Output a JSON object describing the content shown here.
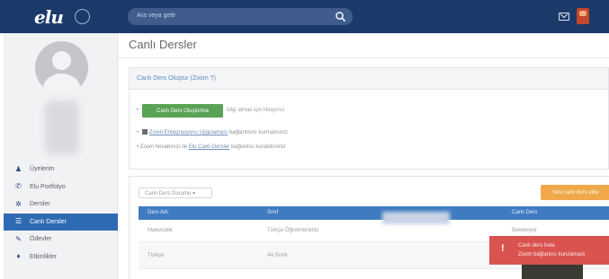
{
  "topbar": {
    "logo": "elu",
    "search_placeholder": "Ara veya getir"
  },
  "sidebar": {
    "items": [
      {
        "icon": "user-icon",
        "glyph": "♟",
        "label": "Üyelerim"
      },
      {
        "icon": "phone-icon",
        "glyph": "✆",
        "label": "Elu Portfolyo"
      },
      {
        "icon": "gear-icon",
        "glyph": "✲",
        "label": "Dersler"
      },
      {
        "icon": "list-icon",
        "glyph": "☰",
        "label": "Canlı Dersler",
        "active": true
      },
      {
        "icon": "wrench-icon",
        "glyph": "✎",
        "label": "Ödevler"
      },
      {
        "icon": "pin-icon",
        "glyph": "♦",
        "label": "Etkinlikler"
      }
    ]
  },
  "main": {
    "page_title": "Canlı Dersler",
    "panel1": {
      "link": "Canlı Ders Oluştur (Zoom ?)",
      "primary_button": "Canlı Ders Oluşturma",
      "primary_note": "bilgi almak için tıklayınız",
      "bullet2_link": "Zoom Entegrasyonu Uygulaması",
      "bullet2_note": "bağlantısını kurmalısınız",
      "bullet3_prefix": "Zoom hesabınızı ile",
      "bullet3_link": "Elu Canlı Dersler",
      "bullet3_note": "bağlantısı kurabilirsiniz"
    },
    "panel2": {
      "filter_value": "Canlı Ders Durumu",
      "add_button": "Yeni canlı ders ekle",
      "columns": [
        "Ders Adı",
        "Sınıf",
        "",
        "Canlı Ders"
      ],
      "rows": [
        {
          "name": "Matematik",
          "class": "Türkçe Öğretmenimiz",
          "status": "Bekleniyor"
        },
        {
          "name": "Türkçe",
          "class": "4A Sınıfı",
          "status": ""
        }
      ]
    }
  },
  "toast": {
    "line1": "Canlı ders hata",
    "line2": "Zoom bağlantısı kurulamadı"
  }
}
